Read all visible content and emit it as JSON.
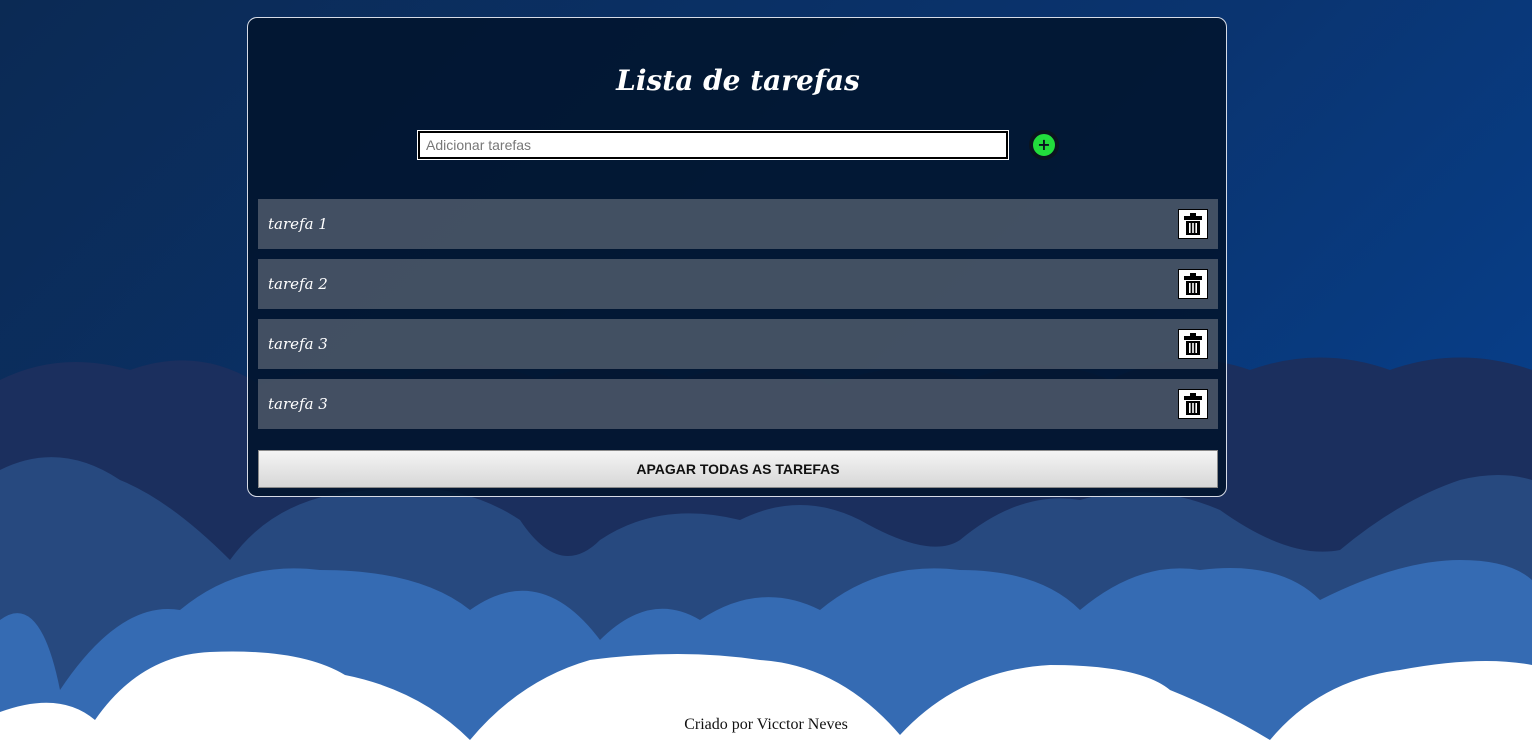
{
  "app": {
    "title": "Lista de tarefas",
    "input": {
      "value": "",
      "placeholder": "Adicionar tarefas"
    },
    "add_button": {
      "icon": "plus-icon",
      "glyph": "+",
      "color": "#22dd3c"
    },
    "tasks": [
      {
        "label": "tarefa 1",
        "delete_icon": "trash-icon"
      },
      {
        "label": "tarefa 2",
        "delete_icon": "trash-icon"
      },
      {
        "label": "tarefa 3",
        "delete_icon": "trash-icon"
      },
      {
        "label": "tarefa 3",
        "delete_icon": "trash-icon"
      }
    ],
    "clear_all_label": "APAGAR TODAS AS TAREFAS"
  },
  "footer": {
    "text": "Criado por Vicctor Neves"
  },
  "colors": {
    "sky": "#0a3470",
    "cloud_dark": "#1b2f5e",
    "cloud_mid": "#27497f",
    "cloud_light": "#356bb3",
    "cloud_white": "#ffffff"
  }
}
